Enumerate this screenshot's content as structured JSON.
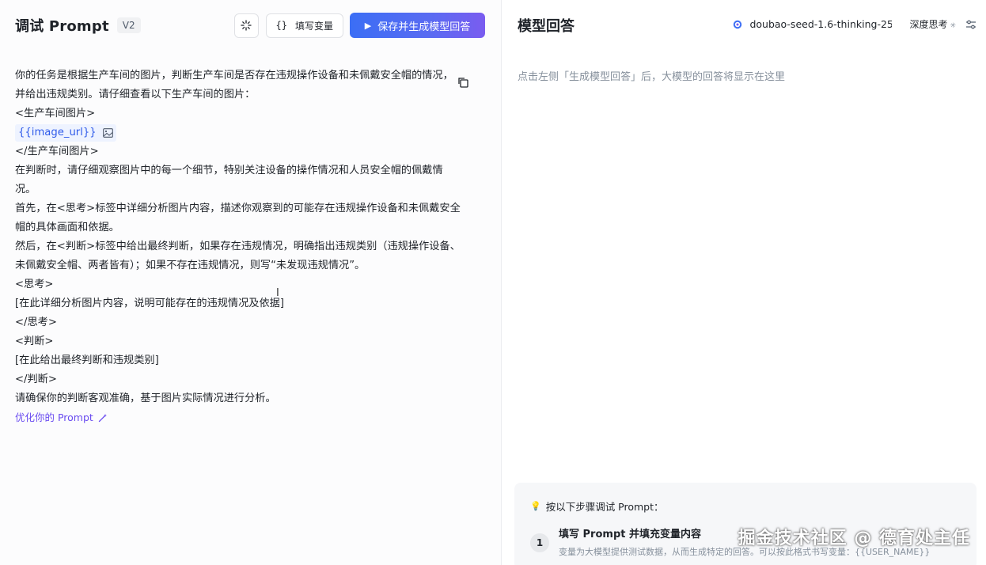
{
  "left": {
    "title": "调试 Prompt",
    "version": "V2",
    "fill_vars_label": "填写变量",
    "fill_vars_braces": "{}",
    "primary_label": "保存并生成模型回答",
    "lines": [
      "你的任务是根据生产车间的图片，判断生产车间是否存在违规操作设备和未佩戴安全帽的情况，",
      "并给出违规类别。请仔细查看以下生产车间的图片：",
      "<生产车间图片>"
    ],
    "variable": "{{image_url}}",
    "lines2": [
      "</生产车间图片>",
      "在判断时，请仔细观察图片中的每一个细节，特别关注设备的操作情况和人员安全帽的佩戴情",
      "况。",
      "首先，在<思考>标签中详细分析图片内容，描述你观察到的可能存在违规操作设备和未佩戴安全",
      "帽的具体画面和依据。",
      "然后，在<判断>标签中给出最终判断，如果存在违规情况，明确指出违规类别（违规操作设备、",
      "未佩戴安全帽、两者皆有）；如果不存在违规情况，则写“未发现违规情况”。",
      "<思考>",
      "[在此详细分析图片内容，说明可能存在的违规情况及依据]",
      "</思考>",
      "<判断>",
      "[在此给出最终判断和违规类别]",
      "</判断>",
      "请确保你的判断客观准确，基于图片实际情况进行分析。"
    ],
    "optimize_label": "优化你的 Prompt"
  },
  "right": {
    "title": "模型回答",
    "model_name": "doubao-seed-1.6-thinking-25...",
    "deep_label": "深度思考",
    "placeholder": "点击左侧「生成模型回答」后，大模型的回答将显示在这里",
    "steps_title": "按以下步骤调试 Prompt：",
    "step1_num": "1",
    "step1_head": "填写 Prompt 并填充变量内容",
    "step1_desc": "变量为大模型提供测试数据，从而生成特定的回答。可以按此格式书写变量：{{USER_NAME}}"
  },
  "watermark": "掘金技术社区 @ 德育处主任",
  "colors": {
    "accent": "#3b6ef5",
    "purple": "#6a4cf0",
    "chip_bg": "#eef3ff"
  }
}
